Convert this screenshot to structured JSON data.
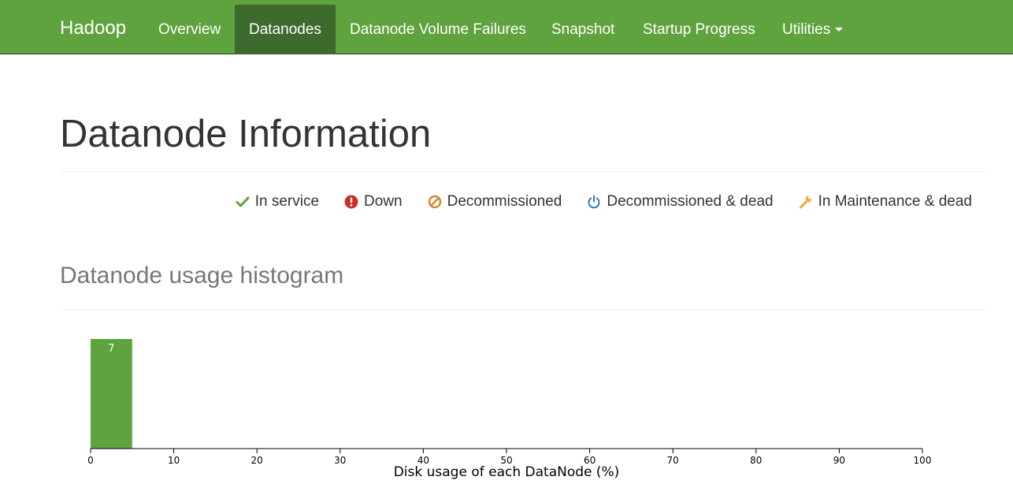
{
  "navbar": {
    "brand": "Hadoop",
    "items": [
      {
        "label": "Overview",
        "active": false
      },
      {
        "label": "Datanodes",
        "active": true
      },
      {
        "label": "Datanode Volume Failures",
        "active": false
      },
      {
        "label": "Snapshot",
        "active": false
      },
      {
        "label": "Startup Progress",
        "active": false
      },
      {
        "label": "Utilities",
        "active": false,
        "dropdown": true
      }
    ]
  },
  "page": {
    "title": "Datanode Information"
  },
  "legend": [
    {
      "label": "In service",
      "icon": "check-icon",
      "color": "#5fa33e"
    },
    {
      "label": "Down",
      "icon": "exclamation-circle-icon",
      "color": "#c9302c"
    },
    {
      "label": "Decommissioned",
      "icon": "ban-icon",
      "color": "#d9822b"
    },
    {
      "label": "Decommissioned & dead",
      "icon": "power-icon",
      "color": "#337ab7"
    },
    {
      "label": "In Maintenance & dead",
      "icon": "wrench-icon",
      "color": "#f0ad4e"
    }
  ],
  "histogram": {
    "title": "Datanode usage histogram"
  },
  "chart_data": {
    "type": "bar",
    "xlabel": "Disk usage of each DataNode (%)",
    "xlim": [
      0,
      100
    ],
    "xticks": [
      0,
      10,
      20,
      30,
      40,
      50,
      60,
      70,
      80,
      90,
      100
    ],
    "bins": [
      {
        "x0": 0,
        "x1": 5,
        "count": 7
      }
    ],
    "bar_color": "#5fa33e"
  }
}
